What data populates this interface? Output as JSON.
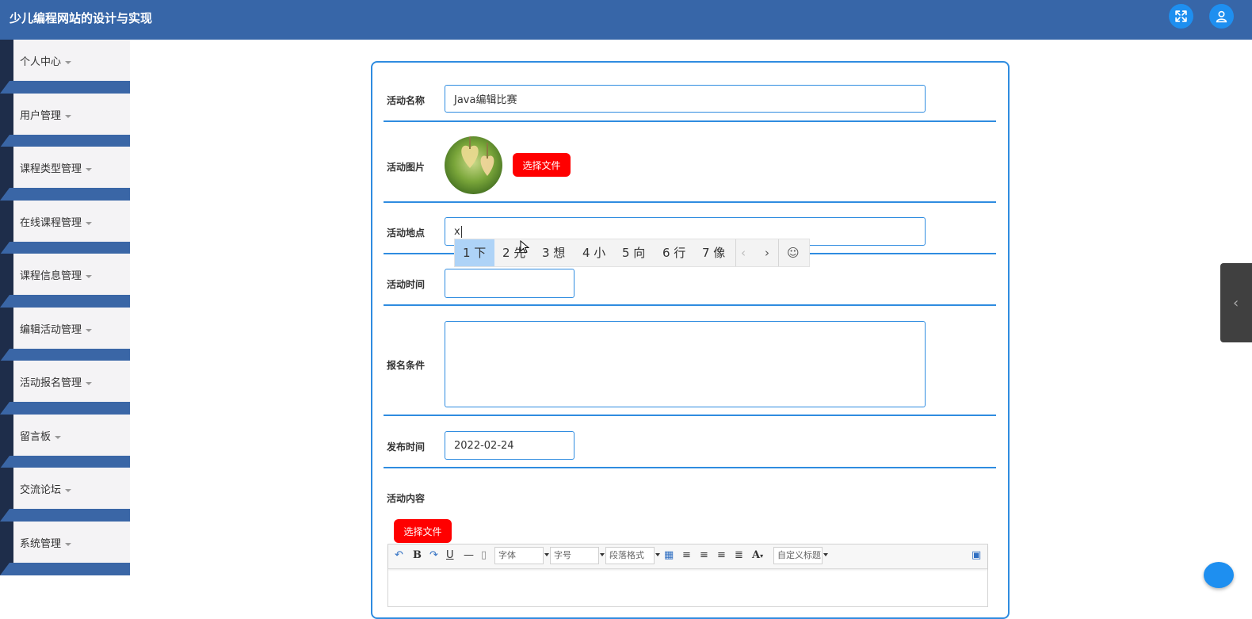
{
  "header": {
    "title": "少儿编程网站的设计与实现",
    "icons": [
      "fullscreen-icon",
      "user-icon"
    ]
  },
  "sidebar": {
    "items": [
      {
        "label": "个人中心"
      },
      {
        "label": "用户管理"
      },
      {
        "label": "课程类型管理"
      },
      {
        "label": "在线课程管理"
      },
      {
        "label": "课程信息管理"
      },
      {
        "label": "编辑活动管理"
      },
      {
        "label": "活动报名管理"
      },
      {
        "label": "留言板"
      },
      {
        "label": "交流论坛"
      },
      {
        "label": "系统管理"
      }
    ]
  },
  "form": {
    "name_label": "活动名称",
    "name_value": "Java编辑比赛",
    "image_label": "活动图片",
    "choose_file": "选择文件",
    "location_label": "活动地点",
    "location_value": "x",
    "time_label": "活动时间",
    "time_value": "",
    "condition_label": "报名条件",
    "condition_value": "",
    "publish_label": "发布时间",
    "publish_value": "2022-02-24",
    "content_label": "活动内容",
    "content_choose_file": "选择文件"
  },
  "ime": {
    "candidates": [
      "1 下",
      "2 先",
      "3 想",
      "4 小",
      "5 向",
      "6 行",
      "7 像"
    ],
    "selected_index": 0
  },
  "editor_toolbar": {
    "font_family": "字体",
    "font_size": "字号",
    "paragraph": "段落格式",
    "custom_title": "自定义标题",
    "bold": "B",
    "underline": "U",
    "font_color": "A"
  },
  "colors": {
    "header_bg": "#3766a8",
    "accent": "#2f8ce0",
    "danger": "#ff0000",
    "sidebar_dark": "#1e2d4a"
  }
}
